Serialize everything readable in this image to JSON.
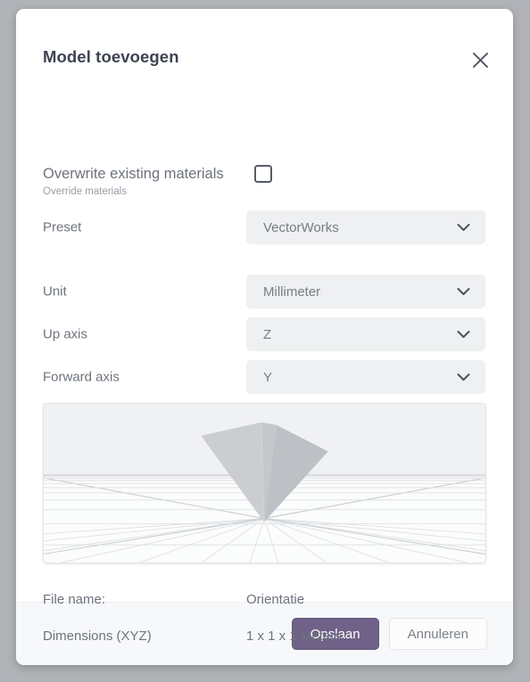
{
  "dialog": {
    "title": "Model toevoegen",
    "close_icon": "close-icon"
  },
  "overwrite": {
    "label": "Overwrite existing materials",
    "sublabel": "Override materials",
    "checked": false
  },
  "fields": [
    {
      "label": "Preset",
      "value": "VectorWorks",
      "icon": "chevron-down-icon"
    },
    {
      "label": "Unit",
      "value": "Millimeter",
      "icon": "chevron-down-icon"
    },
    {
      "label": "Up axis",
      "value": "Z",
      "icon": "chevron-down-icon"
    },
    {
      "label": "Forward axis",
      "value": "Y",
      "icon": "chevron-down-icon"
    }
  ],
  "preview": {
    "name": "model-preview-3d",
    "shape": "inverted-pyramid",
    "face_light": "#cacccf",
    "face_dark": "#bbbec3",
    "sky": "#f0f1f3",
    "ground": "#fbfcfc",
    "grid_color": "#d8dade"
  },
  "info": [
    {
      "key": "File name:",
      "value": "Orientatie"
    },
    {
      "key": "Dimensions (XYZ)",
      "value": "1 x 1 x 1 Meters"
    }
  ],
  "footer": {
    "save_label": "Opslaan",
    "cancel_label": "Annuleren",
    "save_color": "#6f6188",
    "cancel_color": "#fcfcfd"
  }
}
